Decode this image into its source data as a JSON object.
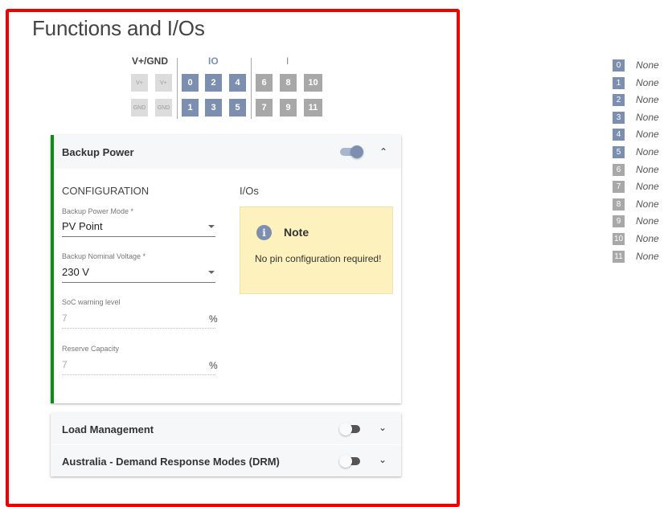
{
  "page": {
    "title": "Functions and I/Os"
  },
  "pin_header": {
    "groups": {
      "power": "V+/GND",
      "io": "IO",
      "input": "I"
    },
    "power_top": [
      "V+",
      "V+"
    ],
    "power_bottom": [
      "GND",
      "GND"
    ],
    "io_top": [
      "0",
      "2",
      "4"
    ],
    "io_bottom": [
      "1",
      "3",
      "5"
    ],
    "input_top": [
      "6",
      "8",
      "10"
    ],
    "input_bottom": [
      "7",
      "9",
      "11"
    ],
    "colors": {
      "io": "#7d8fb0",
      "input": "#a8a8a8",
      "power": "#dcdcdc"
    }
  },
  "backup_power": {
    "title": "Backup Power",
    "enabled": true,
    "expanded": true,
    "accent_color": "#0a8f13",
    "configuration_heading": "CONFIGURATION",
    "ios_heading": "I/Os",
    "fields": {
      "mode": {
        "label": "Backup Power Mode *",
        "value": "PV Point"
      },
      "voltage": {
        "label": "Backup Nominal Voltage *",
        "value": "230 V"
      },
      "soc_warning": {
        "label": "SoC warning level",
        "value": "7",
        "unit": "%"
      },
      "reserve": {
        "label": "Reserve Capacity",
        "value": "7",
        "unit": "%"
      }
    },
    "note": {
      "icon": "info-icon",
      "title": "Note",
      "text": "No pin configuration required!"
    }
  },
  "collapsed_sections": [
    {
      "title": "Load Management",
      "enabled": false
    },
    {
      "title": "Australia - Demand Response Modes (DRM)",
      "enabled": false
    }
  ],
  "pin_assignments": [
    {
      "pin": "0",
      "value": "None"
    },
    {
      "pin": "1",
      "value": "None"
    },
    {
      "pin": "2",
      "value": "None"
    },
    {
      "pin": "3",
      "value": "None"
    },
    {
      "pin": "4",
      "value": "None"
    },
    {
      "pin": "5",
      "value": "None"
    },
    {
      "pin": "6",
      "value": "None"
    },
    {
      "pin": "7",
      "value": "None"
    },
    {
      "pin": "8",
      "value": "None"
    },
    {
      "pin": "9",
      "value": "None"
    },
    {
      "pin": "10",
      "value": "None"
    },
    {
      "pin": "11",
      "value": "None"
    }
  ],
  "colors": {
    "highlight_frame": "#f20000"
  }
}
